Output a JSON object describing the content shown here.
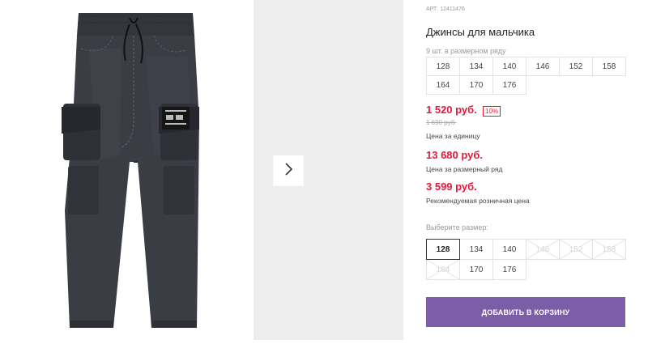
{
  "gallery": {
    "next_icon": "chevron-right-icon",
    "photo_alt": "Джинсы для мальчика"
  },
  "product": {
    "sku": "АРТ: 12411476",
    "title": "Джинсы для мальчика",
    "row_note": "9 шт. в размерном ряду",
    "row_sizes": [
      "128",
      "134",
      "140",
      "146",
      "152",
      "158",
      "164",
      "170",
      "176"
    ],
    "price": "1 520 руб.",
    "discount": "10%",
    "old_price": "1 690 руб.",
    "price_caption": "Цена за единицу",
    "row_price": "13 680 руб.",
    "row_price_caption": "Цена за размерный ряд",
    "retail_price": "3 599 руб.",
    "retail_caption": "Рекомендуемая розничная цена",
    "choose_label": "Выберите размер:",
    "size_options": [
      {
        "label": "128",
        "state": "selected"
      },
      {
        "label": "134",
        "state": "available"
      },
      {
        "label": "140",
        "state": "available"
      },
      {
        "label": "146",
        "state": "disabled"
      },
      {
        "label": "152",
        "state": "disabled"
      },
      {
        "label": "158",
        "state": "disabled"
      },
      {
        "label": "164",
        "state": "disabled"
      },
      {
        "label": "170",
        "state": "available"
      },
      {
        "label": "176",
        "state": "available"
      }
    ],
    "cart_button": "ДОБАВИТЬ В КОРЗИНУ"
  },
  "colors": {
    "accent": "#7b5ea7",
    "price_red": "#e5183b",
    "denim": "#3b3d45"
  }
}
